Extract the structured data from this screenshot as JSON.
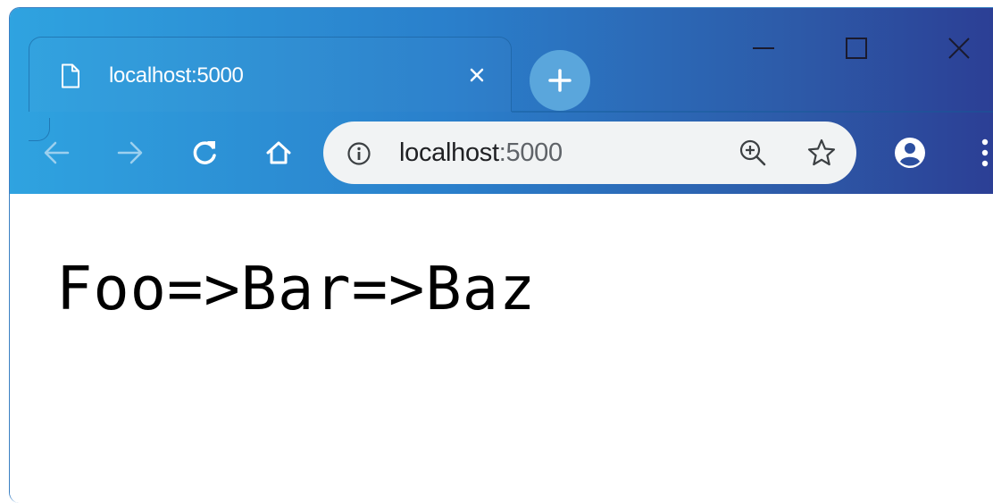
{
  "browser": {
    "tab": {
      "title": "localhost:5000",
      "icon": "page-icon",
      "close_icon": "close-icon"
    },
    "new_tab_icon": "plus-icon",
    "window_controls": {
      "minimize_icon": "minimize-icon",
      "maximize_icon": "maximize-icon",
      "close_icon": "close-icon"
    },
    "toolbar": {
      "back_icon": "back-arrow-icon",
      "forward_icon": "forward-arrow-icon",
      "reload_icon": "reload-icon",
      "home_icon": "home-icon",
      "profile_icon": "account-icon",
      "menu_icon": "kebab-menu-icon"
    },
    "omnibox": {
      "info_icon": "info-icon",
      "url_host": "localhost",
      "url_port": ":5000",
      "zoom_icon": "zoom-in-icon",
      "bookmark_icon": "star-icon"
    }
  },
  "page": {
    "text": "Foo=>Bar=>Baz"
  },
  "colors": {
    "chrome_gradient_start": "#2fa3e0",
    "chrome_gradient_end": "#2c3f95",
    "omnibox_bg": "#f1f3f4",
    "new_tab_button": "#5aa6dc"
  }
}
